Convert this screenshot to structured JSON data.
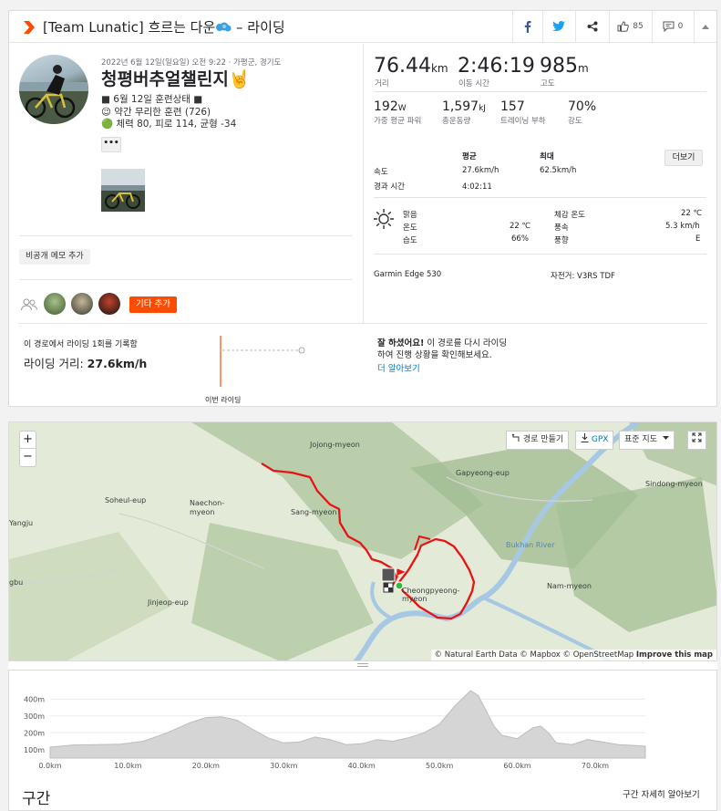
{
  "header": {
    "title_prefix": "[Team Lunatic] 흐르는 다운",
    "title_suffix": " – 라이딩",
    "like_count": "85",
    "comment_count": "0"
  },
  "activity": {
    "date": "2022년 6월 12일(일요일) 오전 9:22 · 가평군, 경기도",
    "title": "청평버추얼챌린지🤘",
    "desc_line1": "■ 6월 12일 훈련상태 ■",
    "desc_line2": "😉 약간 무리한 훈련 (726)",
    "desc_line3": "🟢 체력 80, 피로 114, 균형 -34",
    "more_label": "•••",
    "private_note_label": "비공개 메모 추가",
    "etc_add_label": "기타 추가"
  },
  "stats": {
    "distance": "76.44",
    "distance_unit": "km",
    "distance_label": "거리",
    "moving_time": "2:46:19",
    "moving_time_label": "이동 시간",
    "elevation": "985",
    "elevation_unit": "m",
    "elevation_label": "고도",
    "power": "192",
    "power_unit": "W",
    "power_label": "가중 평균 파워",
    "energy": "1,597",
    "energy_unit": "kJ",
    "energy_label": "총운동량",
    "load": "157",
    "load_label": "트레이닝 부하",
    "intensity": "70%",
    "intensity_label": "강도"
  },
  "details": {
    "avg_header": "평균",
    "max_header": "최대",
    "more_btn": "더보기",
    "speed_label": "속도",
    "speed_avg": "27.6km/h",
    "speed_max": "62.5km/h",
    "elapsed_label": "경과 시간",
    "elapsed": "4:02:11"
  },
  "weather": {
    "condition": "맑음",
    "temp_label": "온도",
    "temp": "22 ℃",
    "humidity_label": "습도",
    "humidity": "66%",
    "feels_label": "체감 온도",
    "feels": "22 ℃",
    "wind_label": "풍속",
    "wind": "5.3 km/h",
    "dir_label": "풍향",
    "dir": "E"
  },
  "gear": {
    "device": "Garmin Edge 530",
    "bike": "자전거: V3RS TDF"
  },
  "compare": {
    "line1": "이 경로에서 라이딩 1회를 기록함",
    "line2_prefix": "라이딩 거리: ",
    "line2_value": "27.6km/h",
    "this_ride": "이번 라이딩",
    "msg_bold": "잘 하셨어요!",
    "msg_rest1": " 이 경로를 다시 라이딩",
    "msg_rest2": "하여 진행 상황을 확인해보세요.",
    "learn_more": "더 알아보기"
  },
  "map": {
    "zoom_in": "+",
    "zoom_out": "−",
    "route_btn": "경로 만들기",
    "gpx_btn": "GPX",
    "style_btn": "표준 지도",
    "labels": [
      "Jojong-myeon",
      "Gapyeong-eup",
      "Sindong-myeon",
      "Soheul-eup",
      "Naechon-myeon",
      "Sang-myeon",
      "Yangju",
      "Bukhan River",
      "Nam-myeon",
      "gbu",
      "Jinjeop-eup",
      "Cheongpyeong-myeon"
    ],
    "attribution_prefix": "© Natural Earth Data © Mapbox © OpenStreetMap ",
    "attribution_bold": "Improve this map"
  },
  "elevation": {
    "y_labels": [
      "400m",
      "300m",
      "200m",
      "100m"
    ],
    "x_labels": [
      "0.0km",
      "10.0km",
      "20.0km",
      "30.0km",
      "40.0km",
      "50.0km",
      "60.0km",
      "70.0km"
    ],
    "profile": [
      [
        0,
        115
      ],
      [
        3,
        128
      ],
      [
        6,
        130
      ],
      [
        9,
        132
      ],
      [
        12,
        150
      ],
      [
        15,
        200
      ],
      [
        18,
        260
      ],
      [
        20,
        290
      ],
      [
        22,
        295
      ],
      [
        24,
        275
      ],
      [
        26,
        220
      ],
      [
        28,
        170
      ],
      [
        30,
        140
      ],
      [
        32,
        145
      ],
      [
        34,
        175
      ],
      [
        36,
        160
      ],
      [
        38,
        130
      ],
      [
        40,
        135
      ],
      [
        42,
        160
      ],
      [
        44,
        150
      ],
      [
        46,
        170
      ],
      [
        48,
        200
      ],
      [
        50,
        250
      ],
      [
        52,
        360
      ],
      [
        54,
        450
      ],
      [
        55,
        420
      ],
      [
        56,
        330
      ],
      [
        57,
        240
      ],
      [
        58,
        185
      ],
      [
        60,
        165
      ],
      [
        62,
        230
      ],
      [
        63,
        240
      ],
      [
        64,
        200
      ],
      [
        65,
        140
      ],
      [
        67,
        130
      ],
      [
        69,
        160
      ],
      [
        71,
        145
      ],
      [
        73,
        130
      ],
      [
        75,
        125
      ],
      [
        76.44,
        120
      ]
    ]
  },
  "segments": {
    "title": "구간",
    "detail_link": "구간 자세히 알아보기"
  }
}
